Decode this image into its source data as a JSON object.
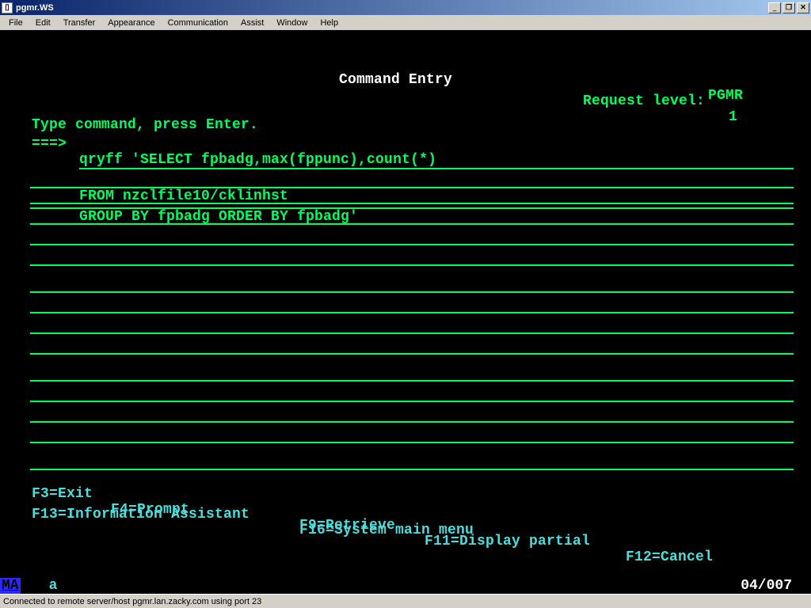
{
  "window": {
    "title": "pgmr.WS"
  },
  "menu": {
    "items": [
      "File",
      "Edit",
      "Transfer",
      "Appearance",
      "Communication",
      "Assist",
      "Window",
      "Help"
    ]
  },
  "screen": {
    "title": "Command Entry",
    "user": "PGMR",
    "request_level_label": "Request level:",
    "request_level_value": "1",
    "instruction": "Type command, press Enter.",
    "prompt": "===>",
    "command_lines": [
      "qryff 'SELECT fpbadg,max(fppunc),count(*)",
      "FROM nzclfile10/cklinhst",
      "GROUP BY fpbadg ORDER BY fpbadg'"
    ],
    "fkeys_row1": [
      {
        "key": "F3=Exit"
      },
      {
        "key": "F4=Prompt"
      },
      {
        "key": "F9=Retrieve"
      },
      {
        "key": "F11=Display partial"
      },
      {
        "key": "F12=Cancel"
      }
    ],
    "fkeys_row2": [
      {
        "key": "F13=Information Assistant"
      },
      {
        "key": "F16=System main menu"
      }
    ]
  },
  "oia": {
    "status": "MA",
    "indicator": "a",
    "cursor": "04/007"
  },
  "statusbar": {
    "text": "Connected to remote server/host pgmr.lan.zacky.com using port 23"
  }
}
